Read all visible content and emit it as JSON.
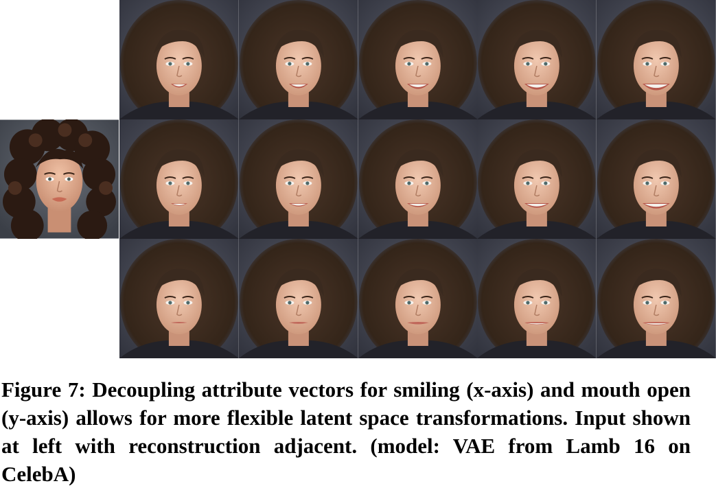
{
  "figure": {
    "input_label": "input-face-image",
    "grid": {
      "rows": 3,
      "cols": 5,
      "row_semantics": [
        "mouth-open-high",
        "mouth-open-medium",
        "mouth-open-low"
      ],
      "col_semantics": [
        "smile-1",
        "smile-2",
        "smile-3",
        "smile-4",
        "smile-5"
      ]
    },
    "colors": {
      "background_dark": "#3d3f4a",
      "hair": "#3a2a1f",
      "skin": "#e7b9a0",
      "input_background": "#4a4f57"
    }
  },
  "caption": {
    "text": "Figure 7: Decoupling attribute vectors for smiling (x-axis) and mouth open (y-axis) allows for more flexible latent space transformations. Input shown at left with reconstruction adjacent. (model: VAE from Lamb 16 on CelebA)"
  }
}
